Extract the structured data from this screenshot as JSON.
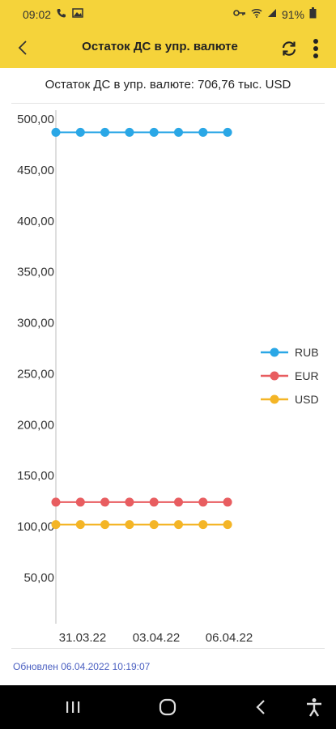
{
  "status_bar": {
    "time": "09:02",
    "battery": "91%",
    "icons_left": [
      "phone-wifi-icon",
      "gallery-icon"
    ],
    "icons_right": [
      "key-icon",
      "wifi-icon",
      "signal-icon",
      "battery-icon"
    ]
  },
  "app_bar": {
    "title": "Остаток ДС в упр. валюте",
    "back_icon": "back-arrow-icon",
    "refresh_icon": "refresh-icon",
    "menu_icon": "more-vert-icon",
    "background": "#f5d33a"
  },
  "summary": {
    "text": "Остаток ДС в упр. валюте: 706,76 тыс. USD"
  },
  "chart_data": {
    "type": "line",
    "title": "",
    "xlabel": "",
    "ylabel": "",
    "ylim": [
      0,
      500
    ],
    "y_ticks": [
      "50,00",
      "100,00",
      "150,00",
      "200,00",
      "250,00",
      "300,00",
      "350,00",
      "400,00",
      "450,00",
      "500,00"
    ],
    "x_tick_labels": [
      "31.03.22",
      "03.04.22",
      "06.04.22"
    ],
    "x": [
      "30.03.22",
      "31.03.22",
      "01.04.22",
      "02.04.22",
      "03.04.22",
      "04.04.22",
      "05.04.22",
      "06.04.22"
    ],
    "series": [
      {
        "name": "RUB",
        "color": "#2aa7e6",
        "values": [
          487,
          487,
          487,
          487,
          487,
          487,
          487,
          487
        ]
      },
      {
        "name": "EUR",
        "color": "#e85d60",
        "values": [
          124,
          124,
          124,
          124,
          124,
          124,
          124,
          124
        ]
      },
      {
        "name": "USD",
        "color": "#f4b526",
        "values": [
          102,
          102,
          102,
          102,
          102,
          102,
          102,
          102
        ]
      }
    ],
    "legend_position": "right",
    "grid": false
  },
  "footer": {
    "updated": "Обновлен 06.04.2022 10:19:07"
  },
  "nav_bar": {
    "recents_icon": "recents-icon",
    "home_icon": "home-icon",
    "back_icon": "nav-back-icon",
    "accessibility_icon": "accessibility-icon"
  }
}
